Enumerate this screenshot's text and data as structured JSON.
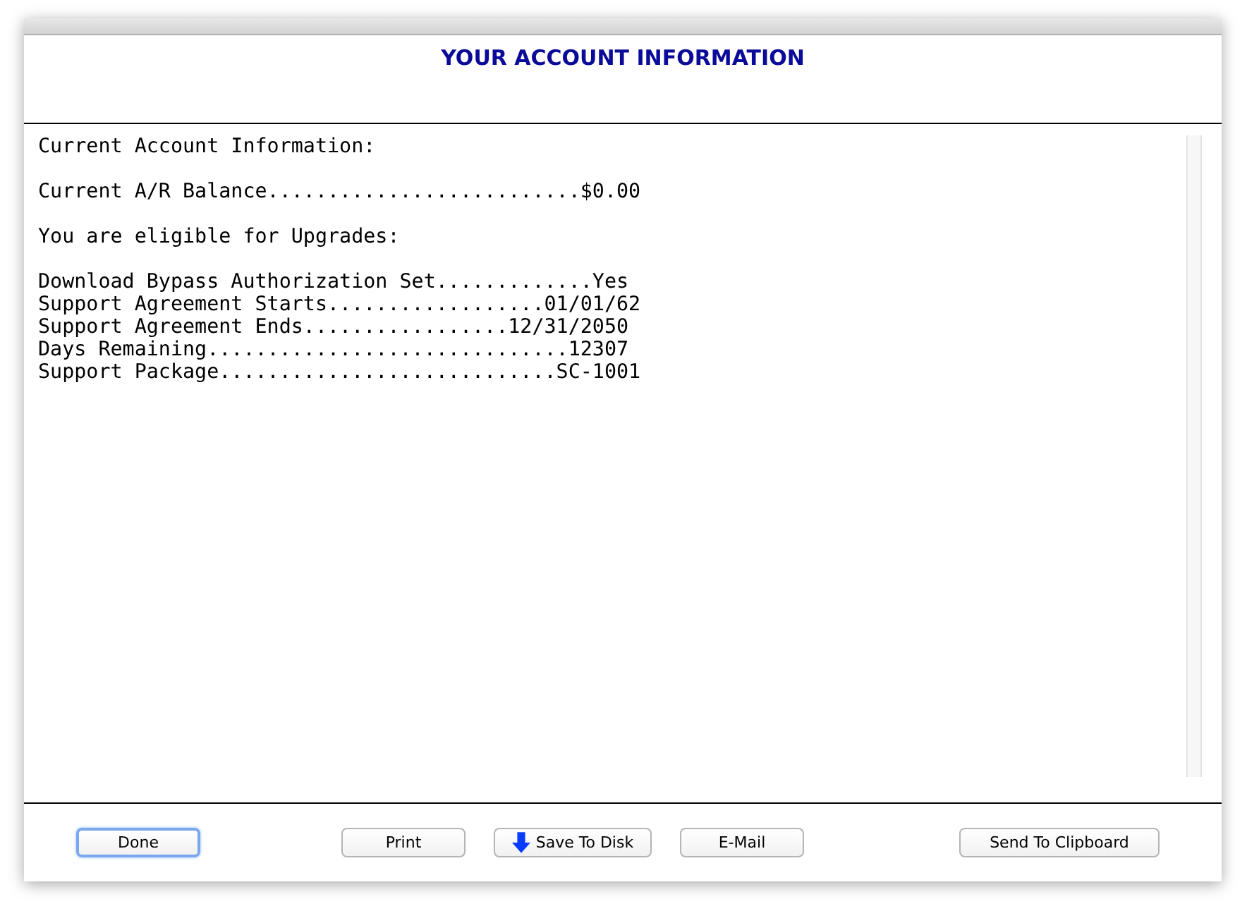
{
  "window": {
    "title": "YOUR ACCOUNT INFORMATION"
  },
  "report": {
    "sections": [
      {
        "lines": [
          "Current Account Information:"
        ]
      },
      {
        "lines": [
          "Current A/R Balance..........................$0.00"
        ]
      },
      {
        "lines": [
          "You are eligible for Upgrades:"
        ]
      },
      {
        "lines": [
          "Download Bypass Authorization Set.............Yes",
          "Support Agreement Starts..................01/01/62",
          "Support Agreement Ends.................12/31/2050",
          "Days Remaining..............................12307",
          "Support Package............................SC-1001"
        ]
      }
    ]
  },
  "buttons": [
    {
      "label": "Done",
      "kind": "plain",
      "focused": true
    },
    {
      "label": "Print",
      "kind": "plain",
      "focused": false
    },
    {
      "label": "Save To Disk",
      "kind": "download",
      "focused": false
    },
    {
      "label": "E-Mail",
      "kind": "plain",
      "focused": false
    },
    {
      "label": "Send To Clipboard",
      "kind": "plain",
      "focused": false
    }
  ]
}
